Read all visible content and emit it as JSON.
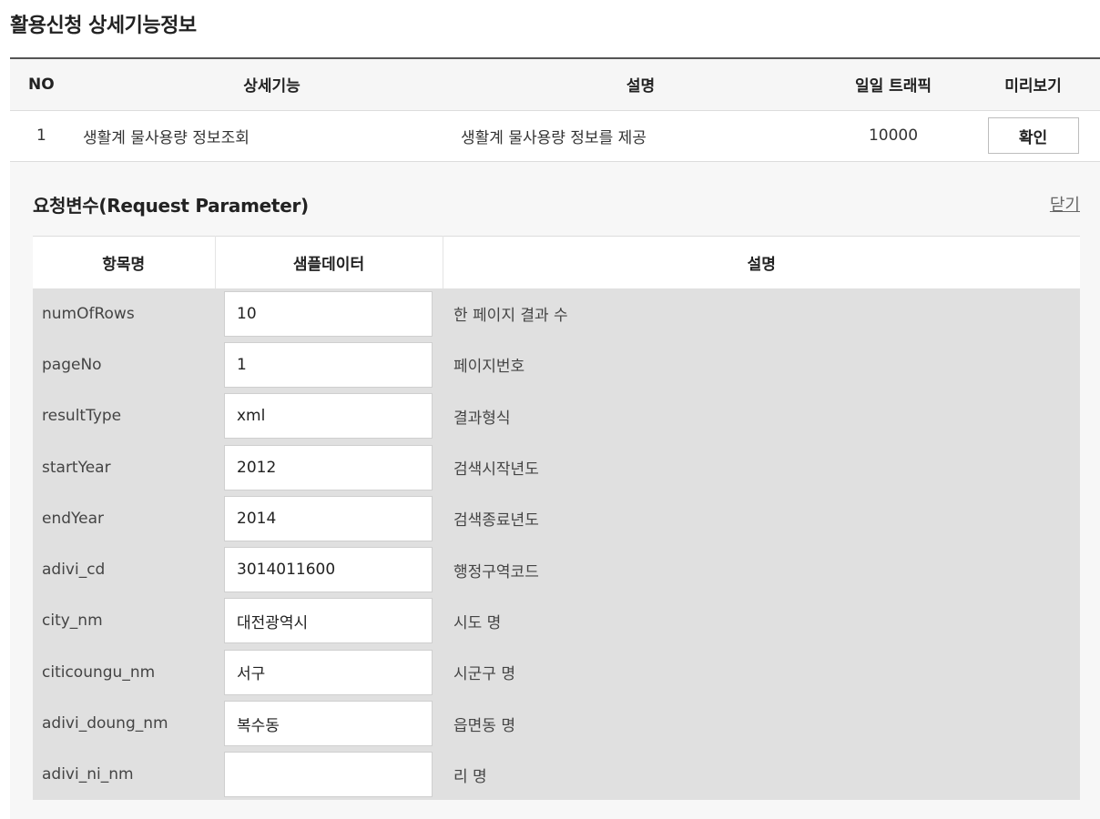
{
  "page_title": "활용신청 상세기능정보",
  "func_table": {
    "headers": {
      "no": "NO",
      "func": "상세기능",
      "desc": "설명",
      "traffic": "일일 트래픽",
      "preview": "미리보기"
    },
    "rows": [
      {
        "no": "1",
        "func": "생활계 물사용량 정보조회",
        "desc": "생활계 물사용량 정보를 제공",
        "traffic": "10000",
        "button": "확인"
      }
    ]
  },
  "request_params": {
    "title": "요청변수(Request Parameter)",
    "close_label": "닫기",
    "headers": {
      "name": "항목명",
      "sample": "샘플데이터",
      "desc": "설명"
    },
    "rows": [
      {
        "name": "numOfRows",
        "value": "10",
        "desc": "한 페이지 결과 수"
      },
      {
        "name": "pageNo",
        "value": "1",
        "desc": "페이지번호"
      },
      {
        "name": "resultType",
        "value": "xml",
        "desc": "결과형식"
      },
      {
        "name": "startYear",
        "value": "2012",
        "desc": "검색시작년도"
      },
      {
        "name": "endYear",
        "value": "2014",
        "desc": "검색종료년도"
      },
      {
        "name": "adivi_cd",
        "value": "3014011600",
        "desc": "행정구역코드"
      },
      {
        "name": "city_nm",
        "value": "대전광역시",
        "desc": "시도 명"
      },
      {
        "name": "citicoungu_nm",
        "value": "서구",
        "desc": "시군구 명"
      },
      {
        "name": "adivi_doung_nm",
        "value": "복수동",
        "desc": "읍면동 명"
      },
      {
        "name": "adivi_ni_nm",
        "value": "",
        "desc": "리 명"
      }
    ]
  }
}
